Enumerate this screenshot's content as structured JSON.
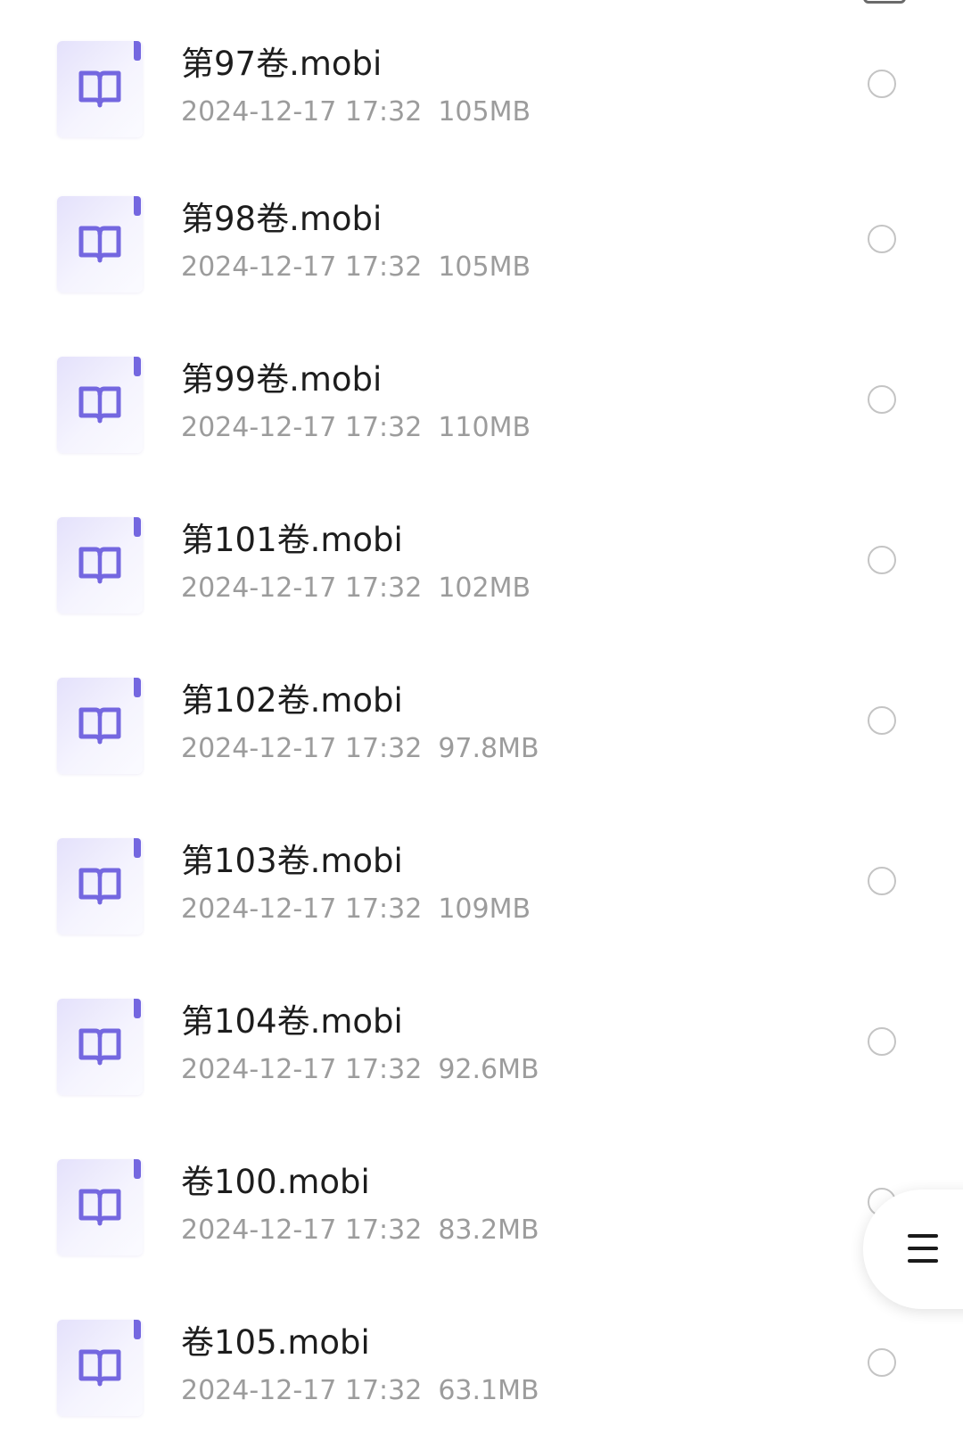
{
  "colors": {
    "accent": "#7467e0",
    "icon_bg": "#eeecfc",
    "title_text": "#1d1d1d",
    "meta_text": "#9c9c9c",
    "circle_border": "#c4c4c4"
  },
  "files": [
    {
      "name": "第97卷.mobi",
      "date": "2024-12-17 17:32",
      "size": "105MB",
      "icon": "book-file-icon",
      "selected": false
    },
    {
      "name": "第98卷.mobi",
      "date": "2024-12-17 17:32",
      "size": "105MB",
      "icon": "book-file-icon",
      "selected": false
    },
    {
      "name": "第99卷.mobi",
      "date": "2024-12-17 17:32",
      "size": "110MB",
      "icon": "book-file-icon",
      "selected": false
    },
    {
      "name": "第101卷.mobi",
      "date": "2024-12-17 17:32",
      "size": "102MB",
      "icon": "book-file-icon",
      "selected": false
    },
    {
      "name": "第102卷.mobi",
      "date": "2024-12-17 17:32",
      "size": "97.8MB",
      "icon": "book-file-icon",
      "selected": false
    },
    {
      "name": "第103卷.mobi",
      "date": "2024-12-17 17:32",
      "size": "109MB",
      "icon": "book-file-icon",
      "selected": false
    },
    {
      "name": "第104卷.mobi",
      "date": "2024-12-17 17:32",
      "size": "92.6MB",
      "icon": "book-file-icon",
      "selected": false
    },
    {
      "name": "卷100.mobi",
      "date": "2024-12-17 17:32",
      "size": "83.2MB",
      "icon": "book-file-icon",
      "selected": false
    },
    {
      "name": "卷105.mobi",
      "date": "2024-12-17 17:32",
      "size": "63.1MB",
      "icon": "book-file-icon",
      "selected": false
    }
  ],
  "fab": {
    "icon": "menu-icon"
  }
}
